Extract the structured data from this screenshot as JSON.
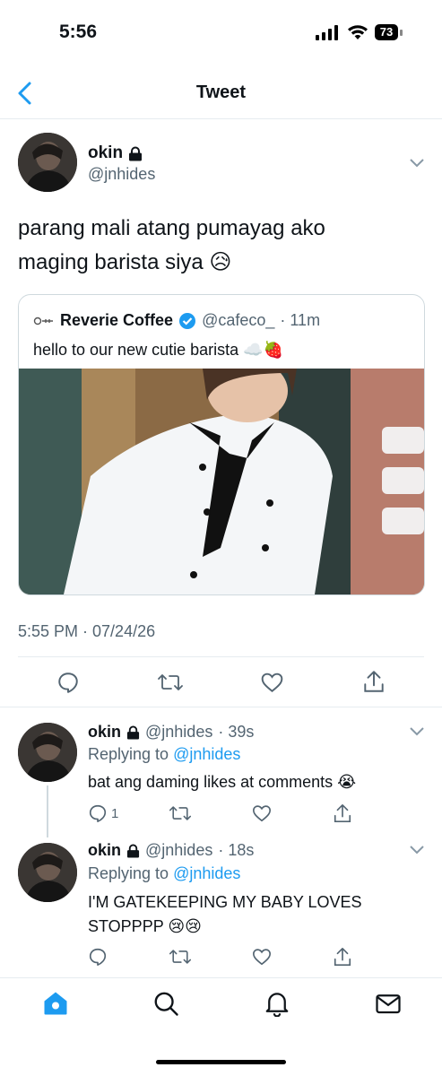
{
  "status_bar": {
    "time": "5:56",
    "battery": "73"
  },
  "nav": {
    "title": "Tweet"
  },
  "tweet": {
    "name": "okin",
    "handle": "@jnhides",
    "text_line1": "parang mali atang pumayag ako",
    "text_line2": "maging barista siya 😥",
    "timestamp": "5:55 PM · 07/24/26"
  },
  "quote": {
    "name": "Reverie Coffee",
    "handle": "@cafeco_",
    "age": "· 11m",
    "text": "hello to our new cutie barista ☁️🍓"
  },
  "replies": [
    {
      "name": "okin",
      "handle": "@jnhides",
      "age": "· 39s",
      "replying_prefix": "Replying to",
      "replying_to": "@jnhides",
      "text": "bat ang daming likes at comments 😭",
      "reply_count": "1"
    },
    {
      "name": "okin",
      "handle": "@jnhides",
      "age": "· 18s",
      "replying_prefix": "Replying to",
      "replying_to": "@jnhides",
      "text_line1": "I'M GATEKEEPING MY BABY LOVES",
      "text_line2": "STOPPPP 😢😢"
    }
  ],
  "icons": {
    "back": "chevron-left-icon",
    "lock": "lock-icon",
    "verified": "verified-badge-icon",
    "reply": "reply-icon",
    "retweet": "retweet-icon",
    "like": "heart-icon",
    "share": "share-icon",
    "home": "home-icon",
    "search": "search-icon",
    "notifications": "bell-icon",
    "messages": "mail-icon"
  },
  "colors": {
    "accent": "#1d9bf0",
    "muted": "#536471",
    "border": "#cfd9de"
  }
}
